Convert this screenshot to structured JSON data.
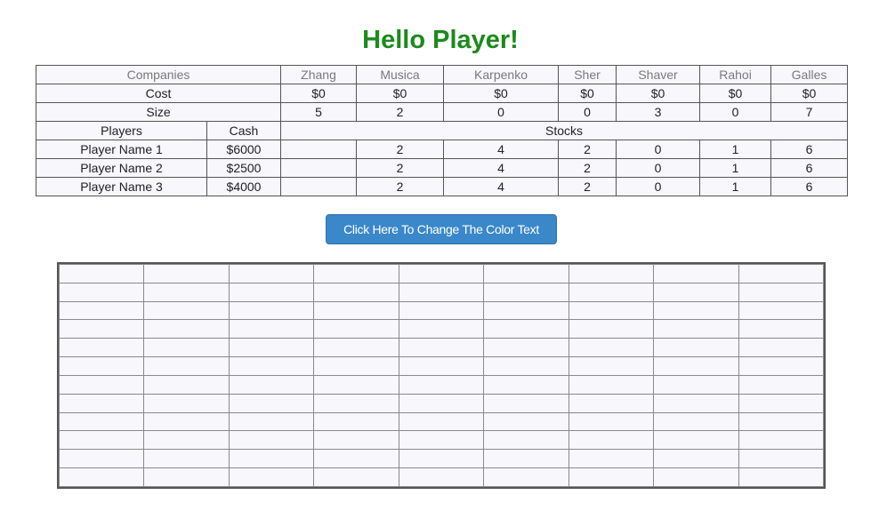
{
  "title": "Hello Player!",
  "companies_label": "Companies",
  "companies": [
    "Zhang",
    "Musica",
    "Karpenko",
    "Sher",
    "Shaver",
    "Rahoi",
    "Galles"
  ],
  "cost_label": "Cost",
  "costs": [
    "$0",
    "$0",
    "$0",
    "$0",
    "$0",
    "$0",
    "$0"
  ],
  "size_label": "Size",
  "sizes": [
    "5",
    "2",
    "0",
    "0",
    "3",
    "0",
    "7"
  ],
  "players_label": "Players",
  "cash_label": "Cash",
  "stocks_label": "Stocks",
  "players": [
    {
      "name": "Player Name 1",
      "cash": "$6000",
      "stocks": [
        "",
        "2",
        "4",
        "2",
        "0",
        "1",
        "6"
      ]
    },
    {
      "name": "Player Name 2",
      "cash": "$2500",
      "stocks": [
        "",
        "2",
        "4",
        "2",
        "0",
        "1",
        "6"
      ]
    },
    {
      "name": "Player Name 3",
      "cash": "$4000",
      "stocks": [
        "",
        "2",
        "4",
        "2",
        "0",
        "1",
        "6"
      ]
    }
  ],
  "button_label": "Click Here To Change The Color Text",
  "title_color": "#1c8a1c",
  "button_color": "#3a87c9"
}
